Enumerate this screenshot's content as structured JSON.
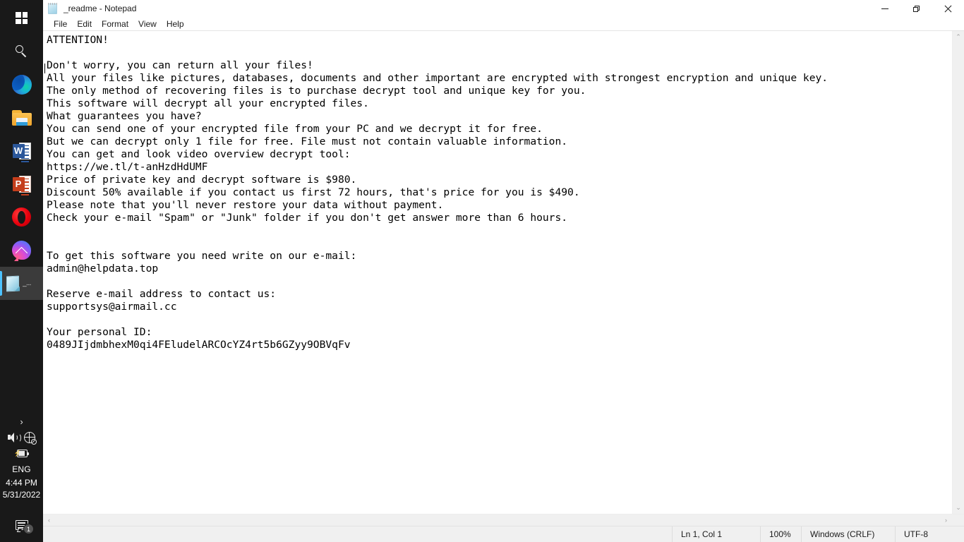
{
  "window": {
    "title": "_readme - Notepad",
    "icon": "notepad-icon",
    "controls": {
      "minimize": "minimize",
      "maximize": "restore",
      "close": "close"
    }
  },
  "menubar": {
    "items": [
      {
        "label": "File"
      },
      {
        "label": "Edit"
      },
      {
        "label": "Format"
      },
      {
        "label": "View"
      },
      {
        "label": "Help"
      }
    ]
  },
  "editor": {
    "content": "ATTENTION!\n\nDon't worry, you can return all your files!\nAll your files like pictures, databases, documents and other important are encrypted with strongest encryption and unique key.\nThe only method of recovering files is to purchase decrypt tool and unique key for you.\nThis software will decrypt all your encrypted files.\nWhat guarantees you have?\nYou can send one of your encrypted file from your PC and we decrypt it for free.\nBut we can decrypt only 1 file for free. File must not contain valuable information.\nYou can get and look video overview decrypt tool:\nhttps://we.tl/t-anHzdHdUMF\nPrice of private key and decrypt software is $980.\nDiscount 50% available if you contact us first 72 hours, that's price for you is $490.\nPlease note that you'll never restore your data without payment.\nCheck your e-mail \"Spam\" or \"Junk\" folder if you don't get answer more than 6 hours.\n\n\nTo get this software you need write on our e-mail:\nadmin@helpdata.top\n\nReserve e-mail address to contact us:\nsupportsys@airmail.cc\n\nYour personal ID:\n0489JIjdmbhexM0qi4FEludelARCOcYZ4rt5b6GZyy9OBVqFv"
  },
  "statusbar": {
    "cursor": "Ln 1, Col 1",
    "zoom": "100%",
    "line_ending": "Windows (CRLF)",
    "encoding": "UTF-8"
  },
  "scrollbars": {
    "up_arrow": "⌃",
    "down_arrow": "⌄",
    "left_arrow": "‹",
    "right_arrow": "›"
  },
  "taskbar": {
    "items": [
      {
        "name": "start-button",
        "label": "Start"
      },
      {
        "name": "search-button",
        "label": "Search"
      },
      {
        "name": "edge-button",
        "label": "Microsoft Edge"
      },
      {
        "name": "file-explorer-button",
        "label": "File Explorer"
      },
      {
        "name": "word-button",
        "label": "W"
      },
      {
        "name": "powerpoint-button",
        "label": "P"
      },
      {
        "name": "opera-button",
        "label": "Opera"
      },
      {
        "name": "messenger-button",
        "label": "Messenger"
      }
    ],
    "active_app": {
      "label": "_...",
      "name": "notepad-taskbar-item"
    },
    "tray": {
      "show_hidden": "›",
      "language": "ENG",
      "time": "4:44 PM",
      "date": "5/31/2022",
      "notification_count": "1"
    }
  },
  "colors": {
    "taskbar_bg": "#191919",
    "window_bg": "#ffffff",
    "statusbar_bg": "#f0f0f0",
    "accent": "#4cc2ff",
    "text": "#000000"
  }
}
